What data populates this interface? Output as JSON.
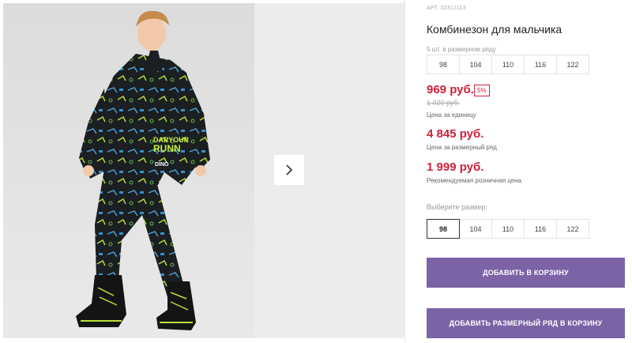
{
  "gallery": {
    "next_icon": "chevron-right-icon"
  },
  "product": {
    "sku": "АРТ. 32312113",
    "title": "Комбинезон для мальчика",
    "series_label": "5 шт. в размерном ряду",
    "series_sizes": [
      "98",
      "104",
      "110",
      "116",
      "122"
    ],
    "price": "969 руб.",
    "discount": "5%",
    "old_price": "1 020 руб.",
    "price_caption": "Цена за единицу",
    "series_price": "4 845 руб.",
    "series_price_caption": "Цена за размерный ряд",
    "rrp_price": "1 999 руб.",
    "rrp_caption": "Рекомендуемая розничная цена",
    "pick_size_label": "Выберите размер:",
    "pick_sizes": [
      "98",
      "104",
      "110",
      "116",
      "122"
    ],
    "selected_size": "98"
  },
  "actions": {
    "add_to_cart": "ДОБАВИТЬ В КОРЗИНУ",
    "add_series_to_cart": "ДОБАВИТЬ РАЗМЕРНЫЙ РЯД В КОРЗИНУ"
  },
  "colors": {
    "accent": "#7b63a6",
    "price": "#d0213b"
  }
}
